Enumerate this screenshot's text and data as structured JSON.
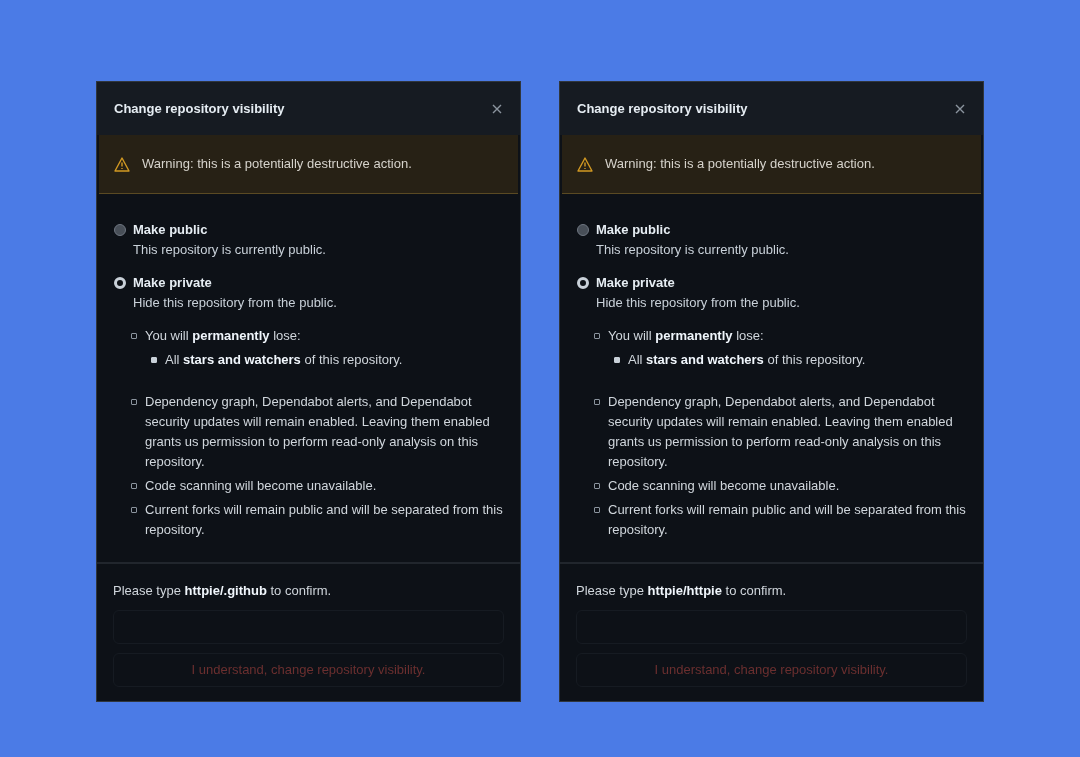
{
  "dialogs": [
    {
      "title": "Change repository visibility",
      "warning": "Warning: this is a potentially destructive action.",
      "options": [
        {
          "label": "Make public",
          "description": "This repository is currently public.",
          "selected": false
        },
        {
          "label": "Make private",
          "description": "Hide this repository from the public.",
          "selected": true
        }
      ],
      "consequences": [
        {
          "text": "You will **permanently** lose:",
          "children": [
            {
              "text": "All **stars and watchers** of this repository."
            }
          ]
        },
        {
          "text": "Dependency graph, Dependabot alerts, and Dependabot security updates will remain enabled. Leaving them enabled grants us permission to perform read-only analysis on this repository."
        },
        {
          "text": "Code scanning will become unavailable."
        },
        {
          "text": "Current forks will remain public and will be separated from this repository."
        }
      ],
      "confirm_prompt": "Please type **httpie/.github** to confirm.",
      "confirm_button": {
        "label": "I understand, change repository visibility.",
        "disabled": true
      }
    },
    {
      "title": "Change repository visibility",
      "warning": "Warning: this is a potentially destructive action.",
      "options": [
        {
          "label": "Make public",
          "description": "This repository is currently public.",
          "selected": false
        },
        {
          "label": "Make private",
          "description": "Hide this repository from the public.",
          "selected": true
        }
      ],
      "consequences": [
        {
          "text": "You will **permanently** lose:",
          "children": [
            {
              "text": "All **stars and watchers** of this repository."
            }
          ]
        },
        {
          "text": "Dependency graph, Dependabot alerts, and Dependabot security updates will remain enabled. Leaving them enabled grants us permission to perform read-only analysis on this repository."
        },
        {
          "text": "Code scanning will become unavailable."
        },
        {
          "text": "Current forks will remain public and will be separated from this repository."
        }
      ],
      "confirm_prompt": "Please type **httpie/httpie** to confirm.",
      "confirm_button": {
        "label": "I understand, change repository visibility.",
        "disabled": true
      }
    }
  ]
}
